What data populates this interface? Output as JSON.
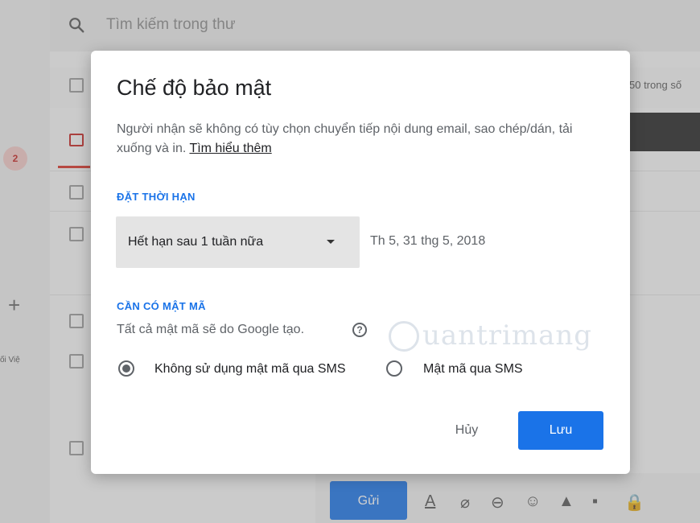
{
  "background": {
    "search_placeholder": "Tìm kiếm trong thư",
    "range_text": "50 trong số",
    "inbox_badge": "2",
    "sidebar_add": "+",
    "sidebar_label": "ối Việ",
    "compose_send_label": "Gửi",
    "compose_icons": [
      "format-text-icon",
      "attach-icon",
      "link-icon",
      "emoji-icon",
      "drive-icon",
      "photo-icon",
      "confidential-lock-icon"
    ]
  },
  "dialog": {
    "title": "Chế độ bảo mật",
    "description": "Người nhận sẽ không có tùy chọn chuyển tiếp nội dung email, sao chép/dán, tải xuống và in.",
    "learn_more": "Tìm hiểu thêm",
    "expiry": {
      "section_label": "ĐẶT THỜI HẠN",
      "selected_option": "Hết hạn sau 1 tuần nữa",
      "date_text": "Th 5, 31 thg 5, 2018"
    },
    "passcode": {
      "section_label": "CẦN CÓ MẬT MÃ",
      "description": "Tất cả mật mã sẽ do Google tạo.",
      "help_symbol": "?",
      "options": [
        {
          "label": "Không sử dụng mật mã qua SMS",
          "selected": true
        },
        {
          "label": "Mật mã qua SMS",
          "selected": false
        }
      ]
    },
    "cancel_label": "Hủy",
    "save_label": "Lưu"
  },
  "watermark": "uantrimang",
  "colors": {
    "accent": "#1a73e8",
    "inbox_red": "#d93025"
  }
}
